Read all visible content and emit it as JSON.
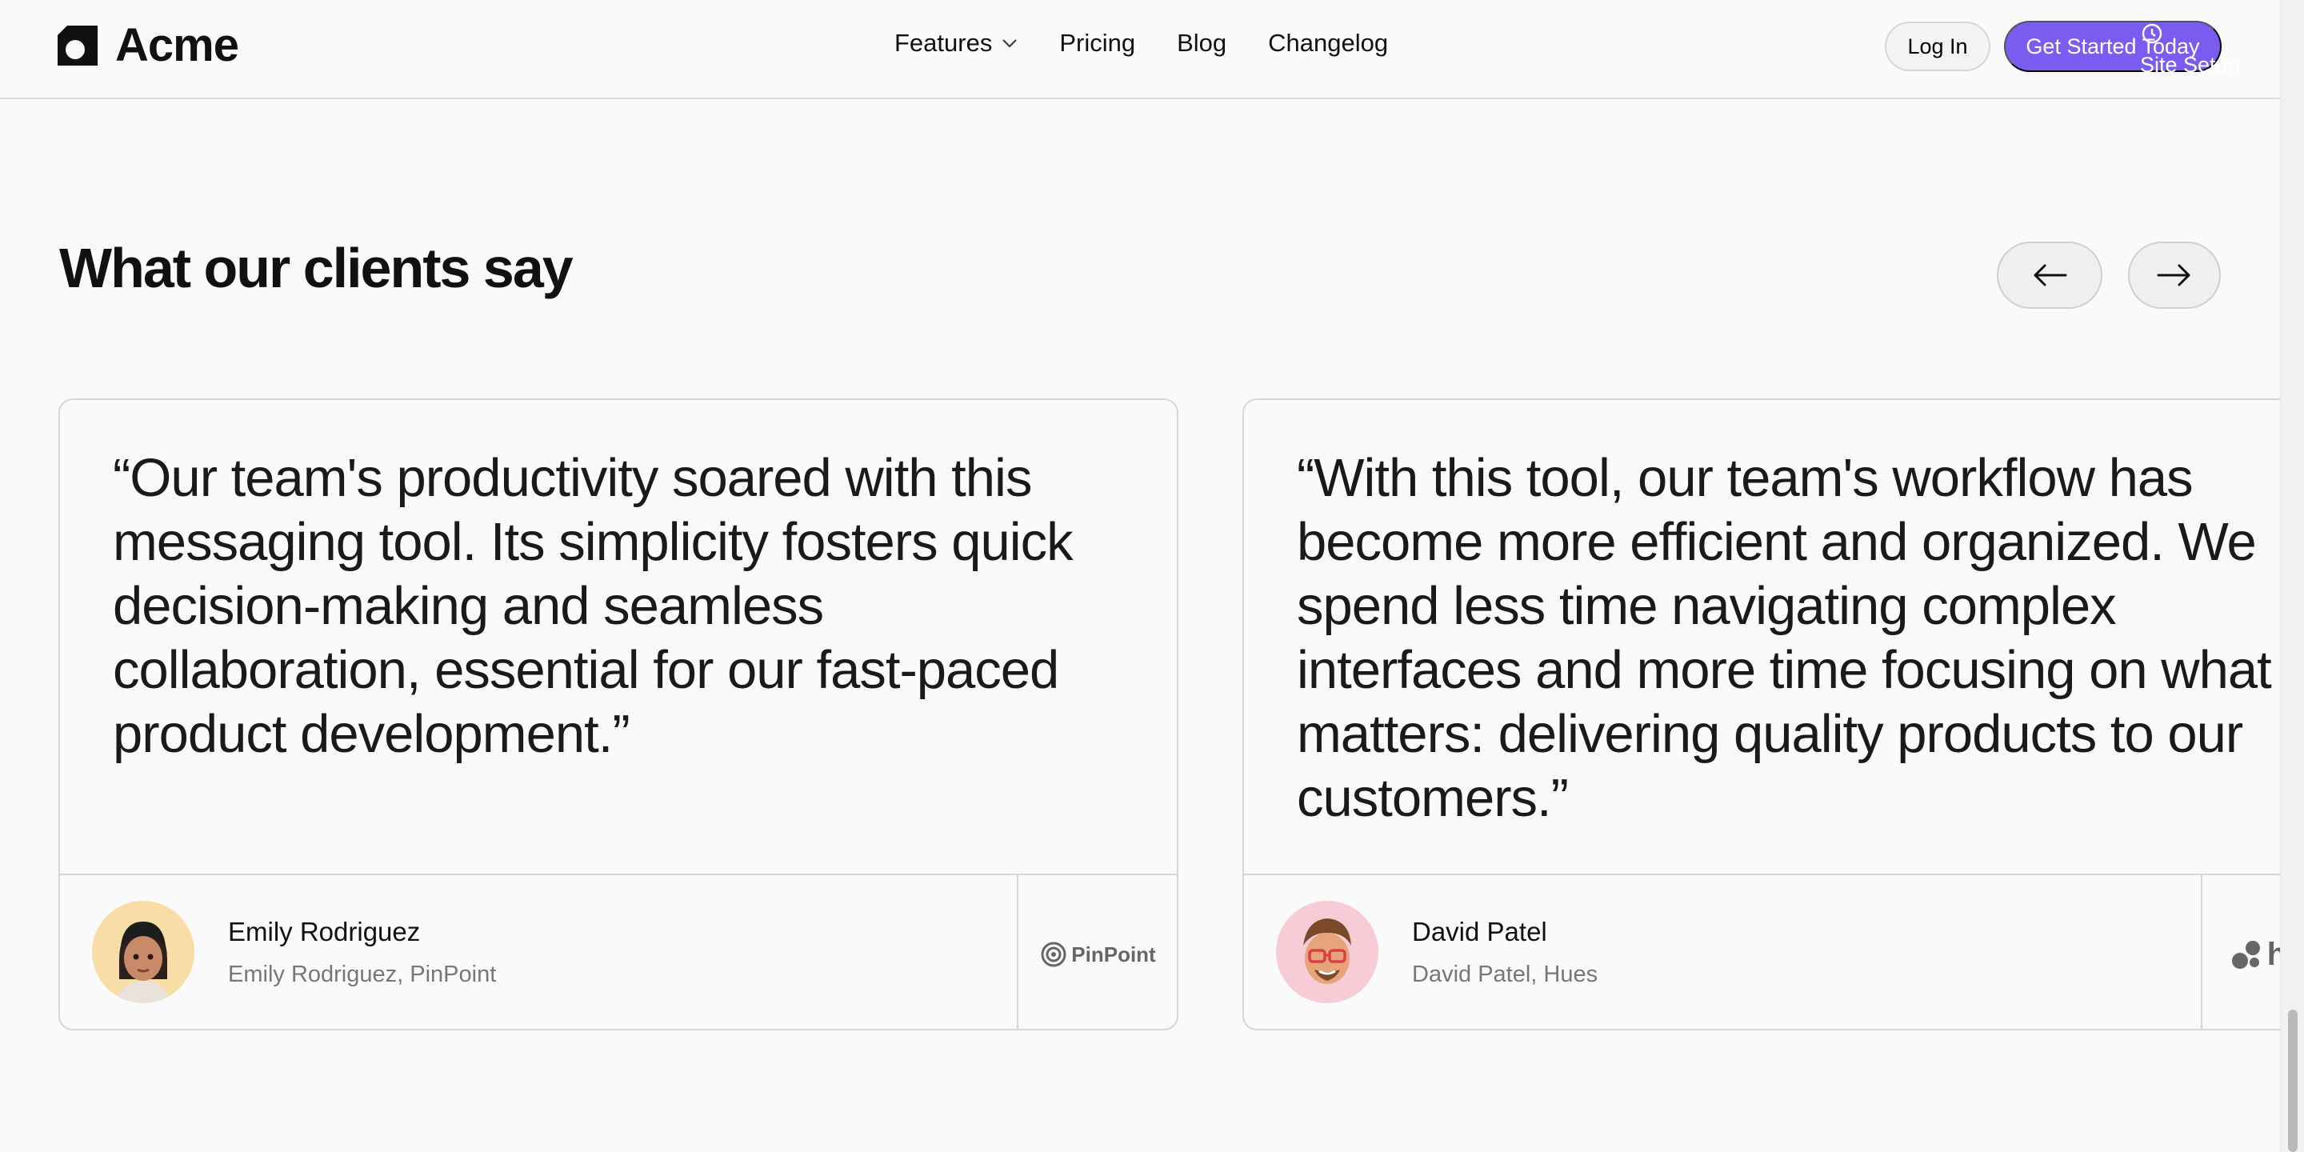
{
  "brand": {
    "name": "Acme"
  },
  "nav": {
    "items": [
      "Features",
      "Pricing",
      "Blog",
      "Changelog"
    ]
  },
  "header": {
    "login_label": "Log In",
    "cta_label": "Get Started Today",
    "overlay_label": "Site Setup"
  },
  "section": {
    "title": "What our clients say"
  },
  "testimonials": [
    {
      "quote": "“Our team's productivity soared with this messaging tool. Its simplicity fosters quick decision-making and seamless collaboration, essential for our fast-paced product development.”",
      "name": "Emily Rodriguez",
      "role": "Emily Rodriguez, PinPoint",
      "company": "PinPoint",
      "avatar_bg": "#f9dda6"
    },
    {
      "quote": "“With this tool, our team's workflow has become more efficient and organized. We spend less time navigating complex interfaces and more time focusing on what matters: delivering quality products to our customers.”",
      "name": "David Patel",
      "role": "David Patel, Hues",
      "company": "h",
      "avatar_bg": "#f7ccd6"
    }
  ],
  "colors": {
    "accent": "#7b5cf0",
    "background": "#fafafa",
    "border": "#d6d6d6",
    "muted_text": "#777777"
  },
  "icons": {
    "arrow_prev": "arrow-left-icon",
    "arrow_next": "arrow-right-icon",
    "features_dropdown": "chevron-down-icon",
    "overlay": "clock-icon"
  }
}
